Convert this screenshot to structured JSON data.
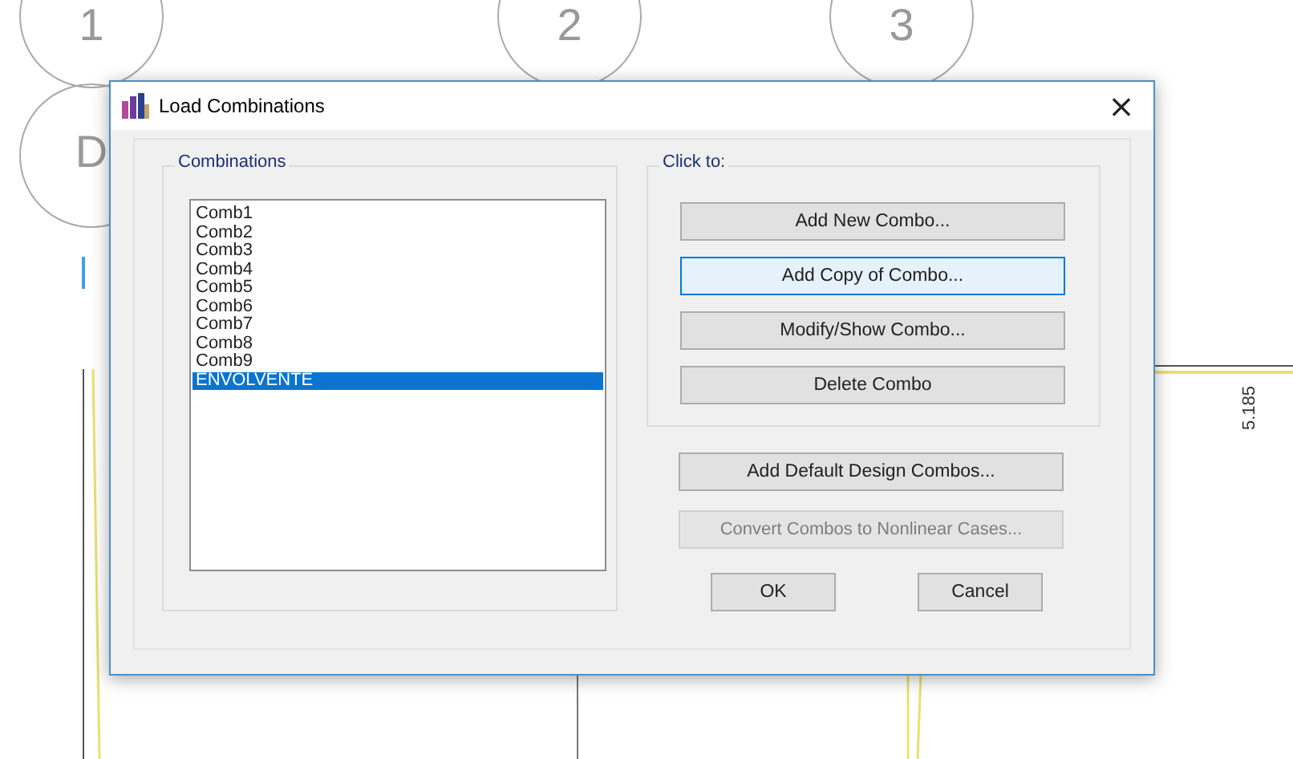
{
  "drawing": {
    "grid_labels": [
      {
        "label": "1"
      },
      {
        "label": "2"
      },
      {
        "label": "3"
      },
      {
        "label": "D"
      }
    ],
    "dimension": "5.185"
  },
  "window": {
    "title": "Load Combinations"
  },
  "combinations": {
    "label": "Combinations",
    "items": [
      {
        "label": "Comb1",
        "selected": false
      },
      {
        "label": "Comb2",
        "selected": false
      },
      {
        "label": "Comb3",
        "selected": false
      },
      {
        "label": "Comb4",
        "selected": false
      },
      {
        "label": "Comb5",
        "selected": false
      },
      {
        "label": "Comb6",
        "selected": false
      },
      {
        "label": "Comb7",
        "selected": false
      },
      {
        "label": "Comb8",
        "selected": false
      },
      {
        "label": "Comb9",
        "selected": false
      },
      {
        "label": "ENVOLVENTE",
        "selected": true
      }
    ]
  },
  "click_to": {
    "label": "Click to:",
    "buttons": [
      {
        "label": "Add New Combo...",
        "focused": false,
        "disabled": false
      },
      {
        "label": "Add Copy of Combo...",
        "focused": true,
        "disabled": false
      },
      {
        "label": "Modify/Show Combo...",
        "focused": false,
        "disabled": false
      },
      {
        "label": "Delete Combo",
        "focused": false,
        "disabled": false
      }
    ]
  },
  "extra_buttons": [
    {
      "label": "Add Default Design Combos...",
      "focused": false,
      "disabled": false
    },
    {
      "label": "Convert Combos to Nonlinear Cases...",
      "focused": false,
      "disabled": true
    }
  ],
  "dialog_buttons": [
    "OK",
    "Cancel"
  ],
  "close_glyph": "×"
}
